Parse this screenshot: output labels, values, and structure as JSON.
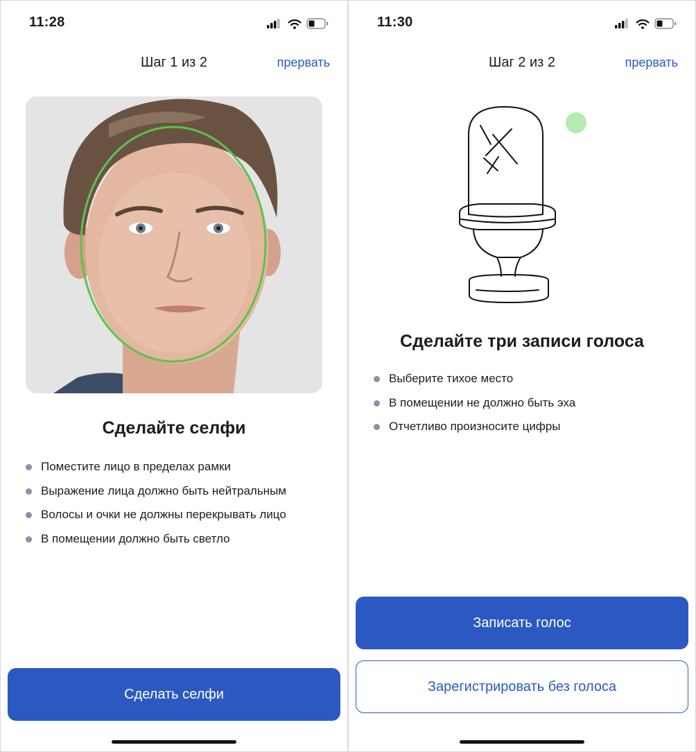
{
  "screens": [
    {
      "status_bar": {
        "time": "11:28"
      },
      "nav": {
        "title": "Шаг 1 из 2",
        "abort_label": "прервать"
      },
      "heading": "Сделайте селфи",
      "bullets": [
        "Поместите лицо в пределах рамки",
        "Выражение лица должно быть нейтральным",
        "Волосы и очки не должны перекрывать лицо",
        "В помещении должно быть светло"
      ],
      "primary_button": "Сделать селфи"
    },
    {
      "status_bar": {
        "time": "11:30"
      },
      "nav": {
        "title": "Шаг 2 из 2",
        "abort_label": "прервать"
      },
      "heading": "Сделайте три записи голоса",
      "bullets": [
        "Выберите тихое место",
        "В помещении не должно быть эха",
        "Отчетливо произносите цифры"
      ],
      "primary_button": "Записать голос",
      "secondary_button": "Зарегистрировать без голоса"
    }
  ],
  "colors": {
    "accent": "#2c59c1",
    "bullet": "#8794a8",
    "face_frame": "#5dc24e",
    "mic_indicator": "#b5eab0"
  },
  "icons": [
    "cellular-signal-icon",
    "wifi-icon",
    "battery-icon",
    "microphone-illustration"
  ]
}
